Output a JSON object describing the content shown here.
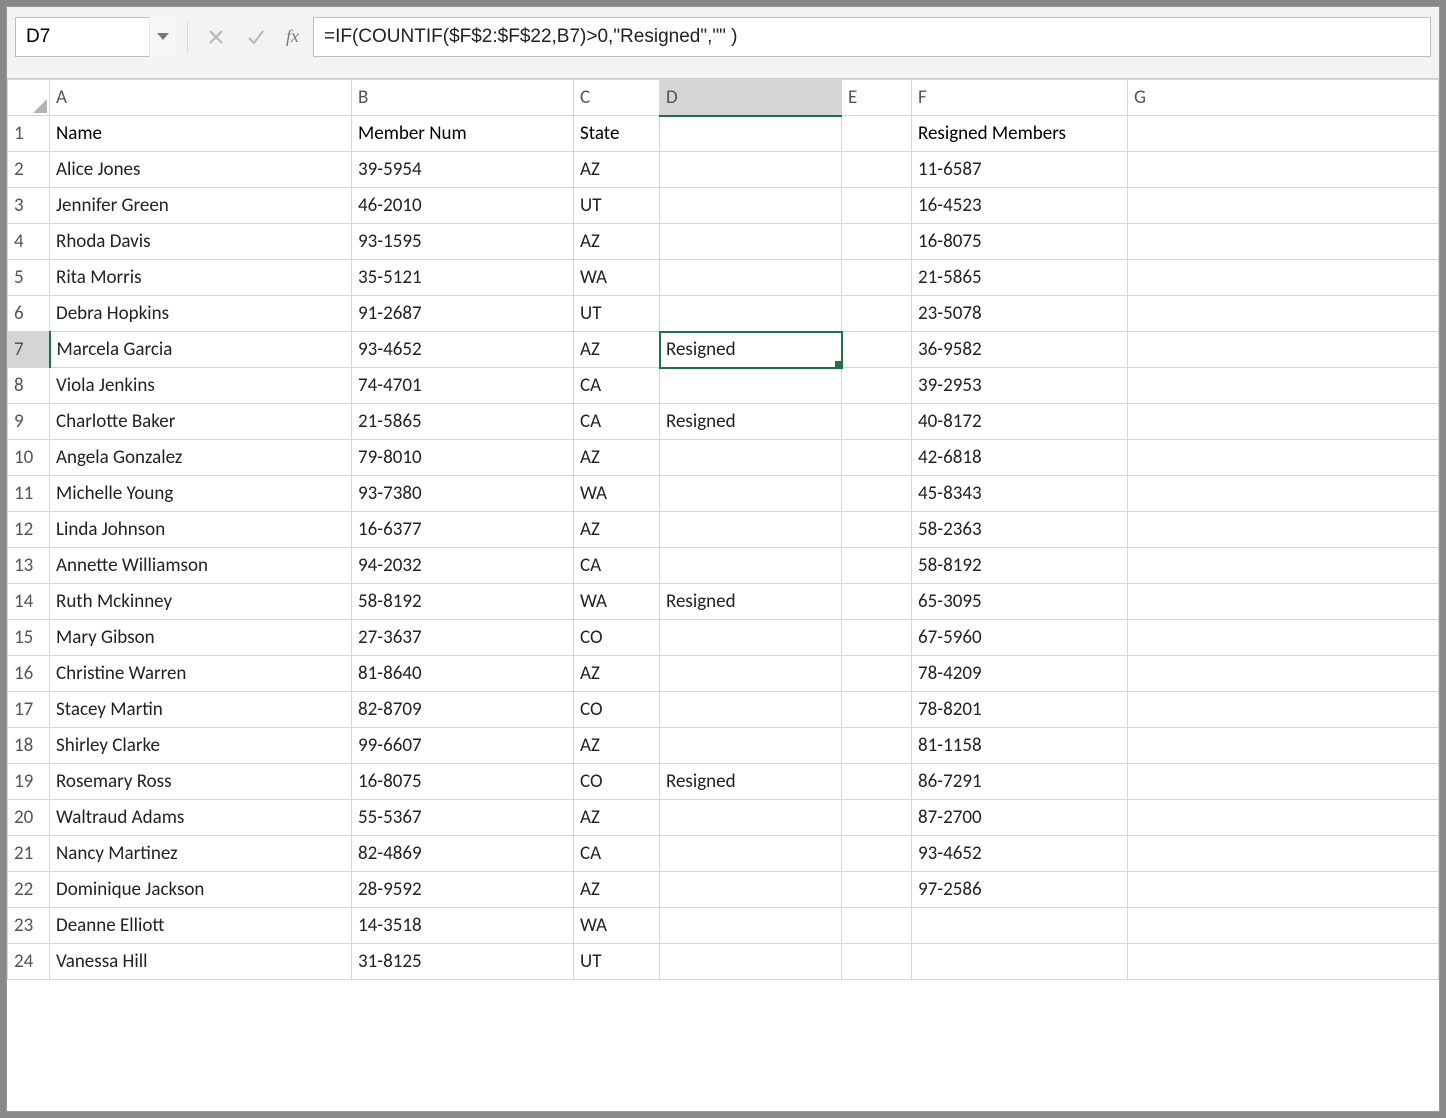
{
  "namebox": {
    "value": "D7"
  },
  "formula_bar": {
    "value": "=IF(COUNTIF($F$2:$F$22,B7)>0,\"Resigned\",\"\" )"
  },
  "fx_label": "fx",
  "columns": [
    "A",
    "B",
    "C",
    "D",
    "E",
    "F",
    "G"
  ],
  "row_numbers": [
    "1",
    "2",
    "3",
    "4",
    "5",
    "6",
    "7",
    "8",
    "9",
    "10",
    "11",
    "12",
    "13",
    "14",
    "15",
    "16",
    "17",
    "18",
    "19",
    "20",
    "21",
    "22",
    "23",
    "24"
  ],
  "selected_cell": "D7",
  "headers": {
    "A": "Name",
    "B": "Member Num",
    "C": "State",
    "F": "Resigned Members"
  },
  "rows": [
    {
      "A": "Alice Jones",
      "B": "39-5954",
      "C": "AZ",
      "D": "",
      "F": "11-6587"
    },
    {
      "A": "Jennifer Green",
      "B": "46-2010",
      "C": "UT",
      "D": "",
      "F": "16-4523"
    },
    {
      "A": "Rhoda Davis",
      "B": "93-1595",
      "C": "AZ",
      "D": "",
      "F": "16-8075"
    },
    {
      "A": "Rita Morris",
      "B": "35-5121",
      "C": "WA",
      "D": "",
      "F": "21-5865"
    },
    {
      "A": "Debra Hopkins",
      "B": "91-2687",
      "C": "UT",
      "D": "",
      "F": "23-5078"
    },
    {
      "A": "Marcela Garcia",
      "B": "93-4652",
      "C": "AZ",
      "D": "Resigned",
      "F": "36-9582"
    },
    {
      "A": "Viola Jenkins",
      "B": "74-4701",
      "C": "CA",
      "D": "",
      "F": "39-2953"
    },
    {
      "A": "Charlotte Baker",
      "B": "21-5865",
      "C": "CA",
      "D": "Resigned",
      "F": "40-8172"
    },
    {
      "A": "Angela Gonzalez",
      "B": "79-8010",
      "C": "AZ",
      "D": "",
      "F": "42-6818"
    },
    {
      "A": "Michelle Young",
      "B": "93-7380",
      "C": "WA",
      "D": "",
      "F": "45-8343"
    },
    {
      "A": "Linda Johnson",
      "B": "16-6377",
      "C": "AZ",
      "D": "",
      "F": "58-2363"
    },
    {
      "A": "Annette Williamson",
      "B": "94-2032",
      "C": "CA",
      "D": "",
      "F": "58-8192"
    },
    {
      "A": "Ruth Mckinney",
      "B": "58-8192",
      "C": "WA",
      "D": "Resigned",
      "F": "65-3095"
    },
    {
      "A": "Mary Gibson",
      "B": "27-3637",
      "C": "CO",
      "D": "",
      "F": "67-5960"
    },
    {
      "A": "Christine Warren",
      "B": "81-8640",
      "C": "AZ",
      "D": "",
      "F": "78-4209"
    },
    {
      "A": "Stacey Martin",
      "B": "82-8709",
      "C": "CO",
      "D": "",
      "F": "78-8201"
    },
    {
      "A": "Shirley Clarke",
      "B": "99-6607",
      "C": "AZ",
      "D": "",
      "F": "81-1158"
    },
    {
      "A": "Rosemary Ross",
      "B": "16-8075",
      "C": "CO",
      "D": "Resigned",
      "F": "86-7291"
    },
    {
      "A": "Waltraud Adams",
      "B": "55-5367",
      "C": "AZ",
      "D": "",
      "F": "87-2700"
    },
    {
      "A": "Nancy Martinez",
      "B": "82-4869",
      "C": "CA",
      "D": "",
      "F": "93-4652"
    },
    {
      "A": "Dominique Jackson",
      "B": "28-9592",
      "C": "AZ",
      "D": "",
      "F": "97-2586"
    },
    {
      "A": "Deanne Elliott",
      "B": "14-3518",
      "C": "WA",
      "D": "",
      "F": ""
    },
    {
      "A": "Vanessa Hill",
      "B": "31-8125",
      "C": "UT",
      "D": "",
      "F": ""
    }
  ]
}
